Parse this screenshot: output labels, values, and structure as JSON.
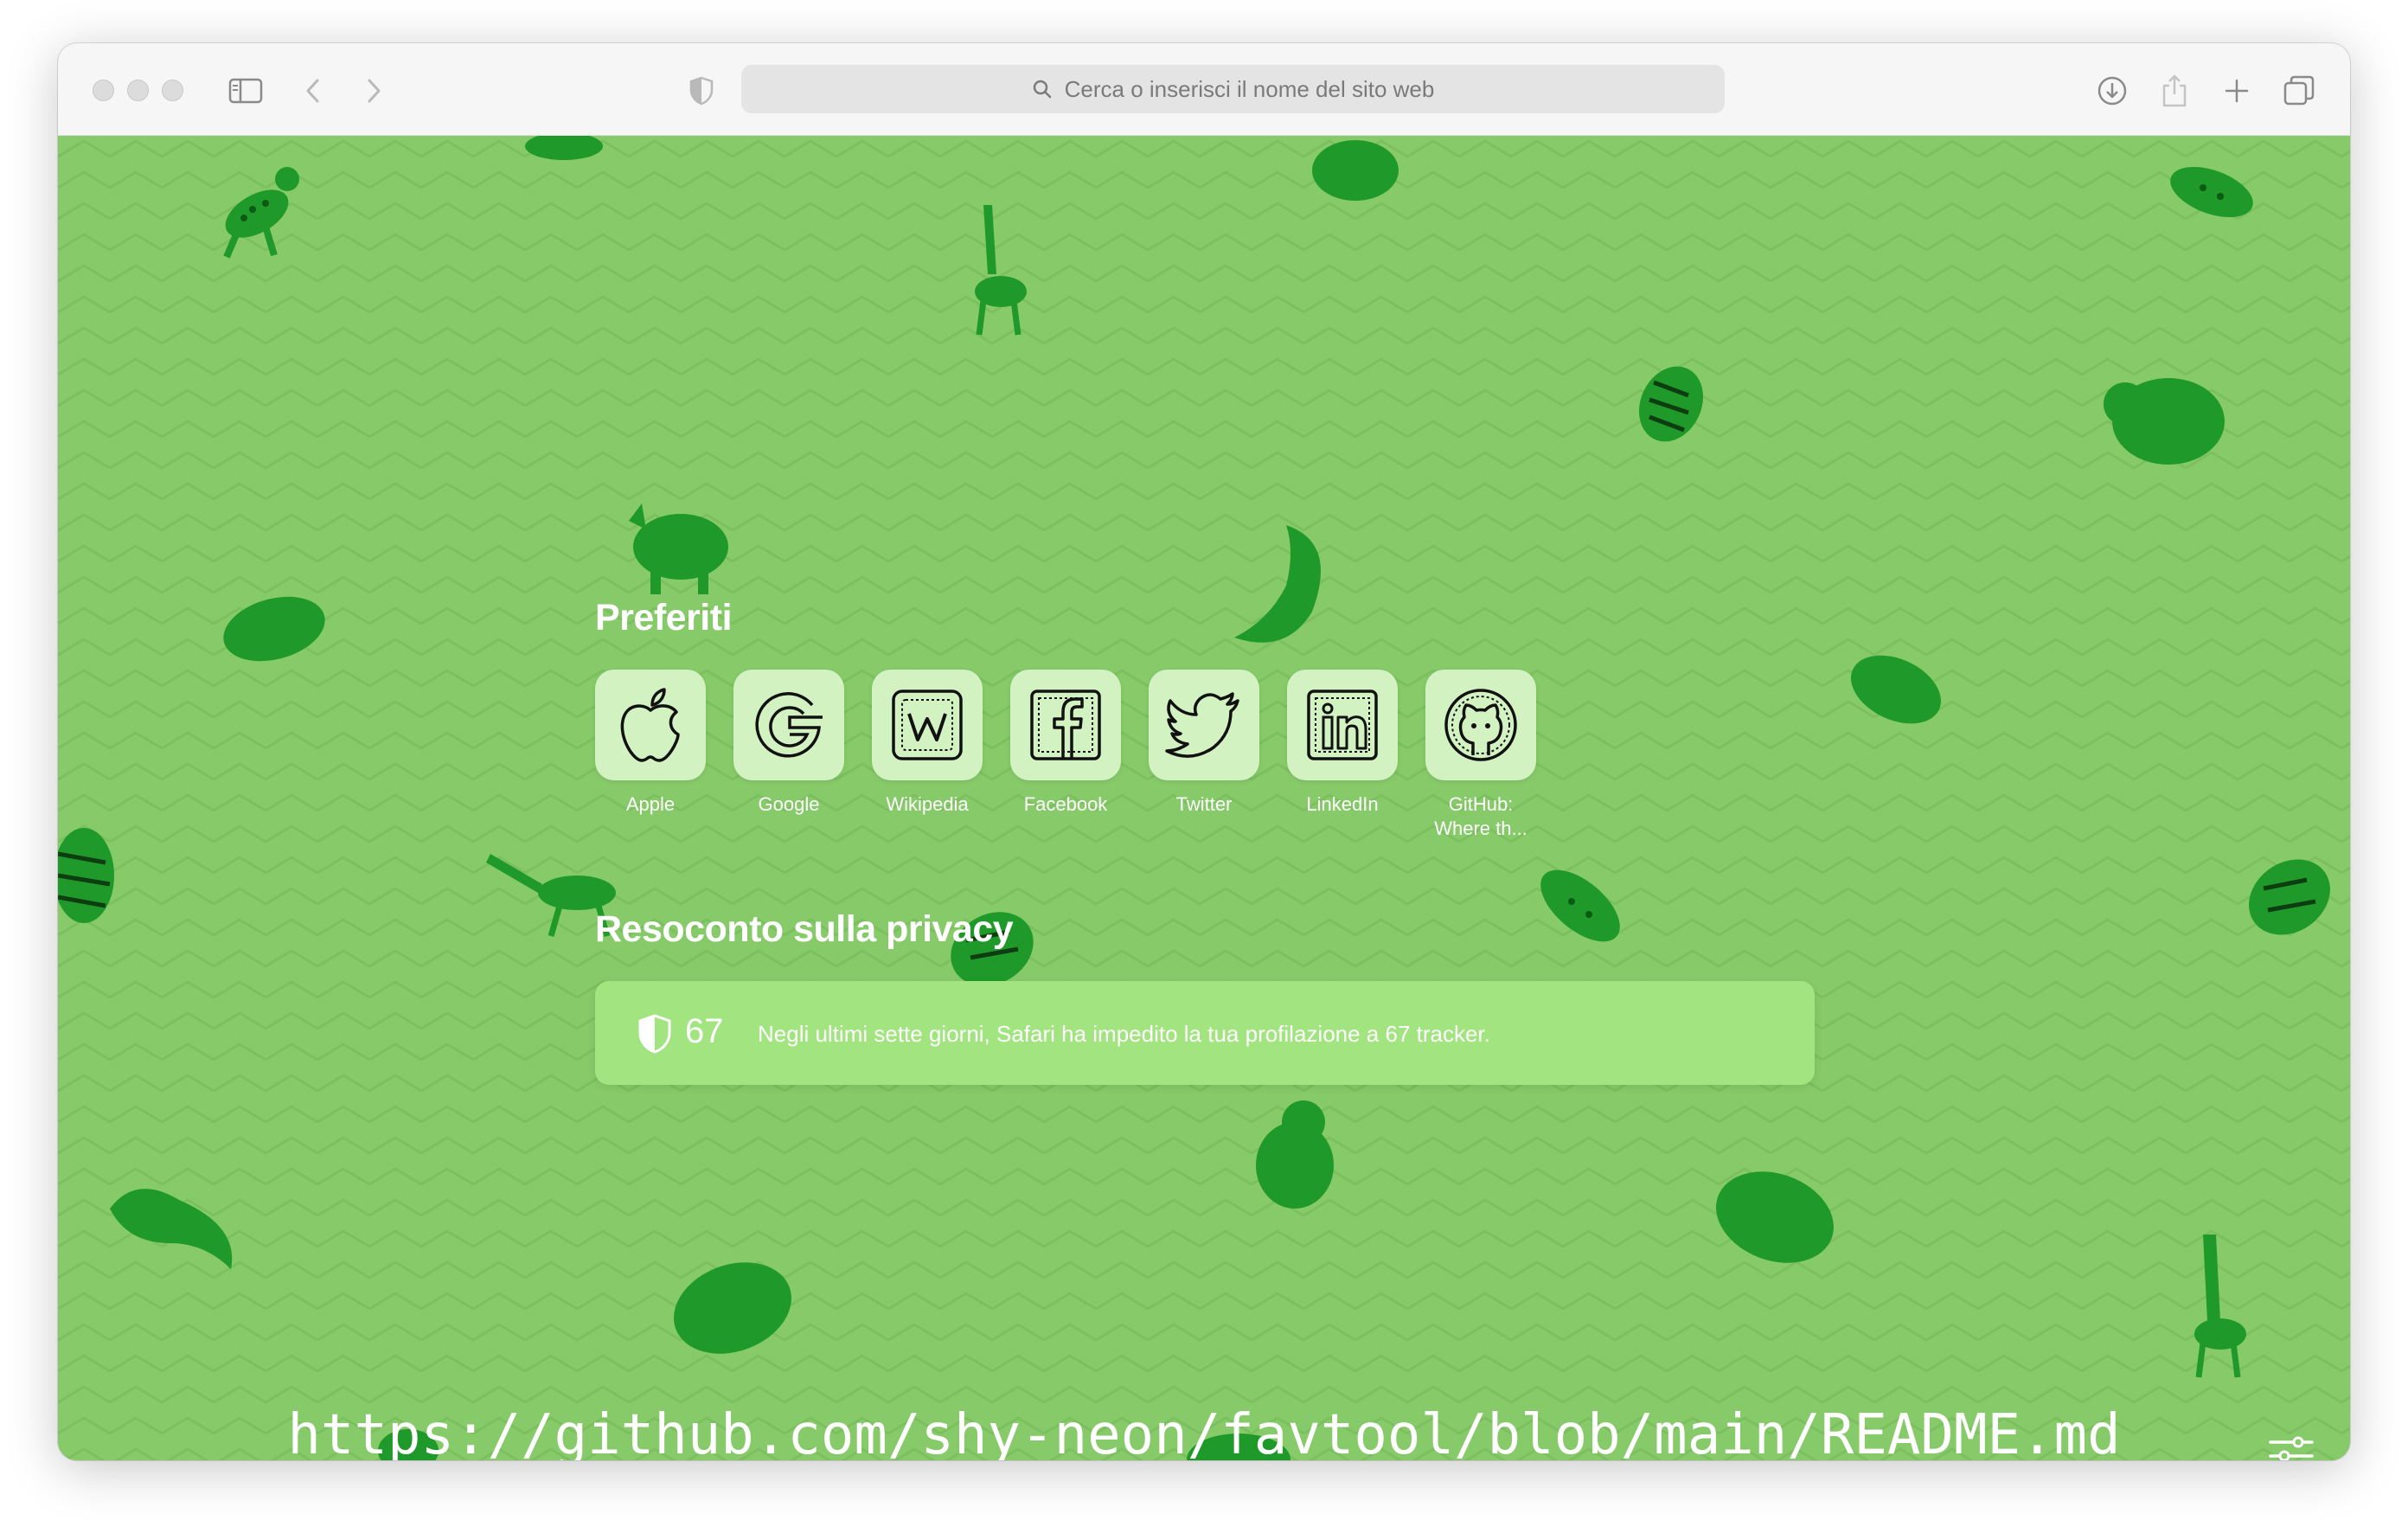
{
  "toolbar": {
    "address_placeholder": "Cerca o inserisci il nome del sito web",
    "icons": [
      "close-dot",
      "minimize-dot",
      "zoom-dot",
      "sidebar-icon",
      "back-arrow-icon",
      "forward-arrow-icon",
      "privacy-shield-icon",
      "search-icon",
      "download-icon",
      "share-icon",
      "new-tab-icon",
      "tab-overview-icon"
    ]
  },
  "favorites": {
    "title": "Preferiti",
    "items": [
      {
        "label": "Apple",
        "icon": "apple-logo-icon"
      },
      {
        "label": "Google",
        "icon": "google-logo-icon"
      },
      {
        "label": "Wikipedia",
        "icon": "wikipedia-logo-icon"
      },
      {
        "label": "Facebook",
        "icon": "facebook-logo-icon"
      },
      {
        "label": "Twitter",
        "icon": "twitter-logo-icon"
      },
      {
        "label": "LinkedIn",
        "icon": "linkedin-logo-icon"
      },
      {
        "label": "GitHub:\nWhere th...",
        "icon": "github-logo-icon"
      }
    ]
  },
  "privacy": {
    "title": "Resoconto sulla privacy",
    "count": "67",
    "message": "Negli ultimi sette giorni, Safari ha impedito la tua profilazione a 67 tracker."
  },
  "overlay_url": "https://github.com/shy-neon/favtool/blob/main/README.md",
  "colors": {
    "background": "#87ca6a",
    "tile": "#d2f2c2",
    "privacy_card": "#a2e47f",
    "animals": "#1f9a2a"
  }
}
